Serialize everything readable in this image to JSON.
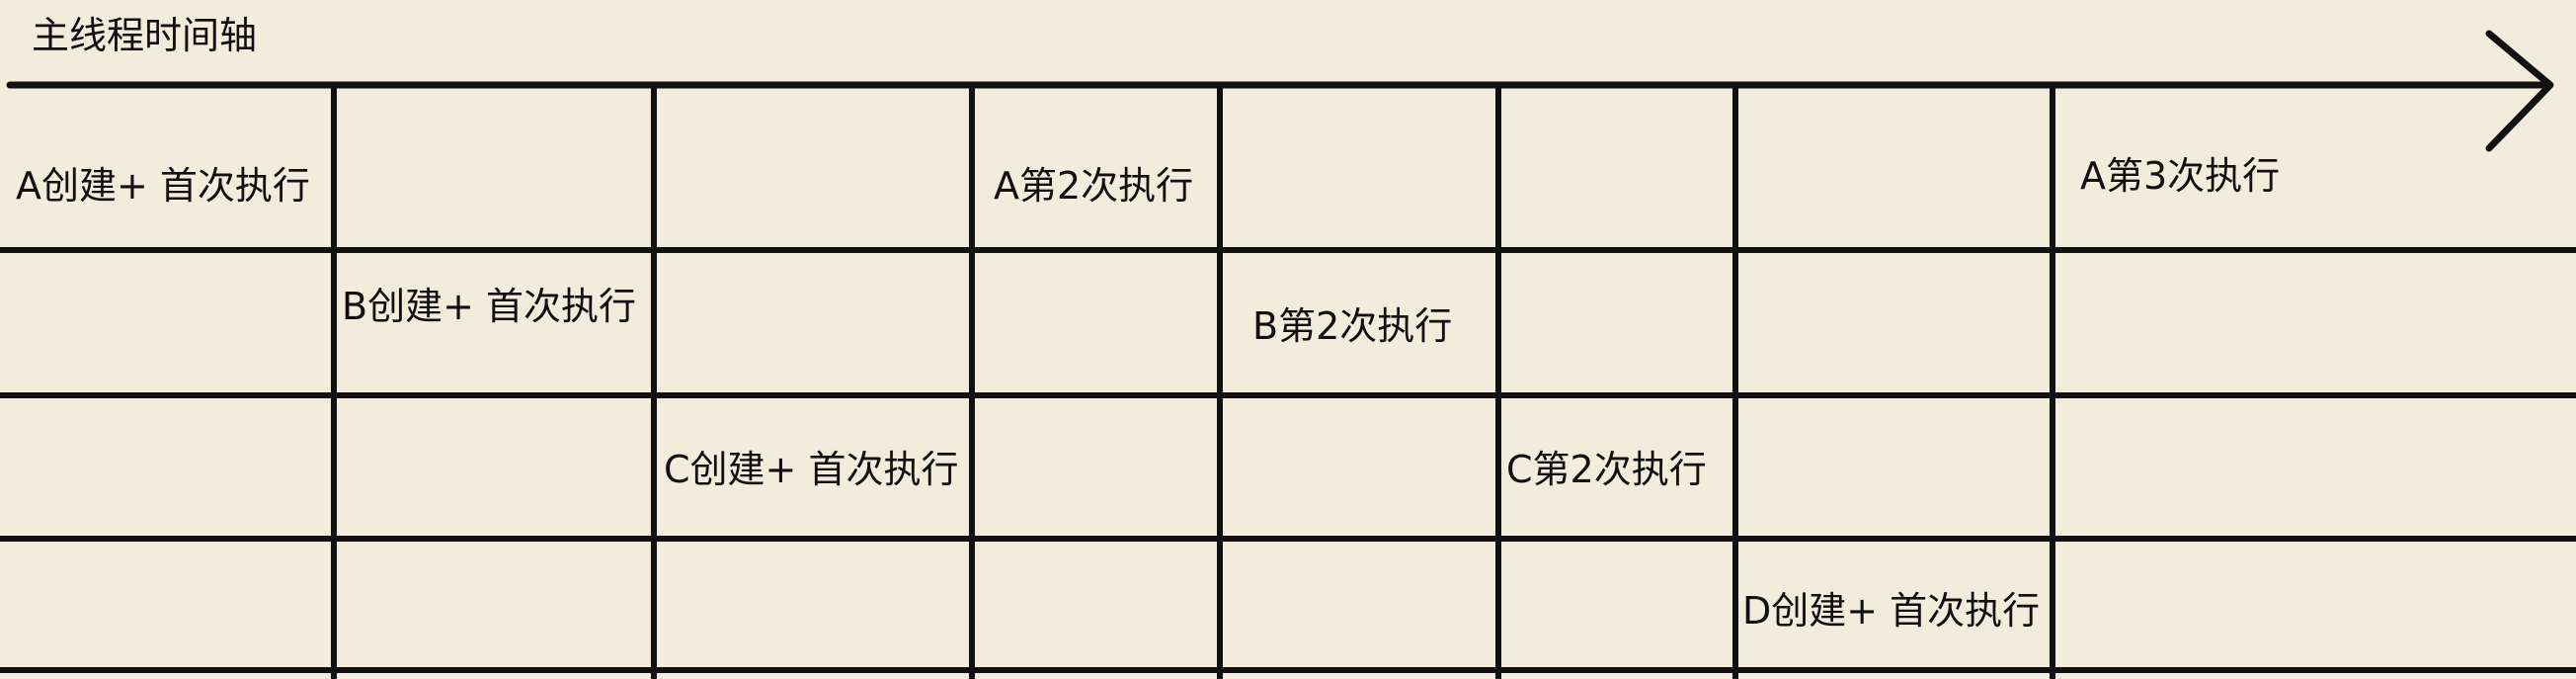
{
  "diagram": {
    "title": "主线程时间轴",
    "colors": {
      "background": "#f2ecdd",
      "line": "#111111",
      "text": "#111111"
    },
    "arrow_icon": "arrow-right-icon",
    "cells": {
      "a_create": "A创建+ 首次执行",
      "a_second": "A第2次执行",
      "a_third": "A第3次执行",
      "b_create": "B创建+ 首次执行",
      "b_second": "B第2次执行",
      "c_create": "C创建+ 首次执行",
      "c_second": "C第2次执行",
      "d_create": "D创建+ 首次执行"
    }
  }
}
